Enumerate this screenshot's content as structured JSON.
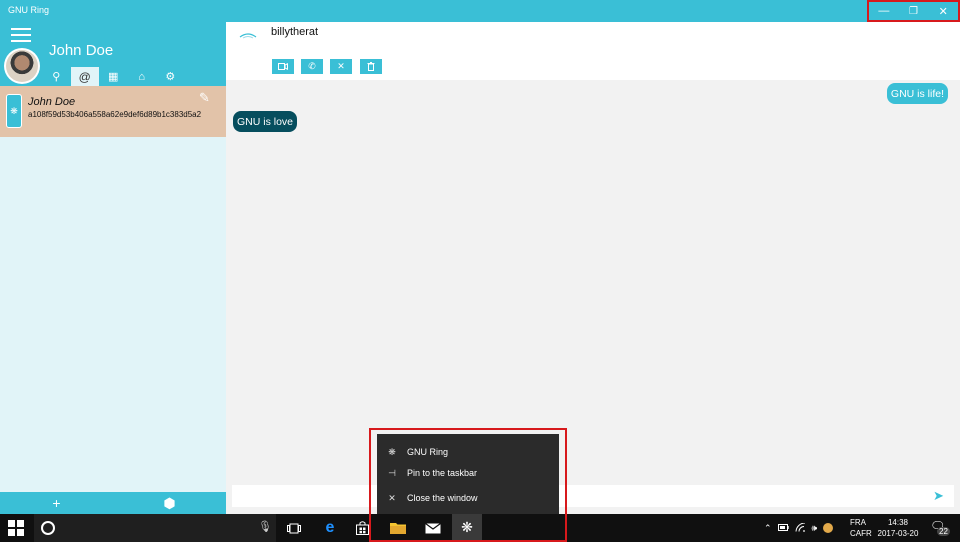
{
  "window": {
    "title": "GNU Ring",
    "controls": {
      "minimize": "—",
      "maximize": "❐",
      "close": "✕"
    }
  },
  "sidebar": {
    "account_name": "John Doe",
    "account_tabs": [
      {
        "icon": "contact-request-icon",
        "glyph": "⚲"
      },
      {
        "icon": "at-sign-icon",
        "glyph": "@"
      },
      {
        "icon": "qr-code-icon",
        "glyph": "▦"
      },
      {
        "icon": "devices-icon",
        "glyph": "⌂"
      },
      {
        "icon": "settings-icon",
        "glyph": "⚙"
      }
    ],
    "contacts": [
      {
        "name": "John Doe",
        "hash": "a108f59d53b406a558a62e9def6d89b1c383d5a2",
        "avatar_text": "RING"
      }
    ],
    "footer": {
      "add_glyph": "+",
      "box_glyph": "⬢"
    }
  },
  "chat": {
    "peer_name": "billytherat",
    "actions": [
      {
        "name": "video-call-button",
        "icon": "video-camera-icon",
        "glyph": "▭"
      },
      {
        "name": "audio-call-button",
        "icon": "phone-icon",
        "glyph": "✆"
      },
      {
        "name": "block-button",
        "icon": "close-icon",
        "glyph": "✕"
      },
      {
        "name": "delete-button",
        "icon": "trash-icon",
        "glyph": "🗑"
      }
    ],
    "messages": [
      {
        "direction": "out",
        "text": "GNU is life!"
      },
      {
        "direction": "in",
        "text": "GNU is love"
      }
    ],
    "composer_placeholder": ""
  },
  "jump_list": {
    "items": [
      {
        "label": "GNU Ring",
        "glyph": "❋"
      },
      {
        "label": "Pin to the taskbar",
        "glyph": "⊣"
      },
      {
        "label": "Close the window",
        "glyph": "✕"
      }
    ]
  },
  "taskbar": {
    "language": {
      "line1": "FRA",
      "line2": "CAFR"
    },
    "time": "14:38",
    "date": "2017-03-20",
    "notification_count": "22"
  },
  "colors": {
    "accent": "#3abfd6",
    "selected_contact": "#e2c3a9",
    "incoming_bubble": "#064e5e",
    "highlight_outline": "#d7191c"
  }
}
